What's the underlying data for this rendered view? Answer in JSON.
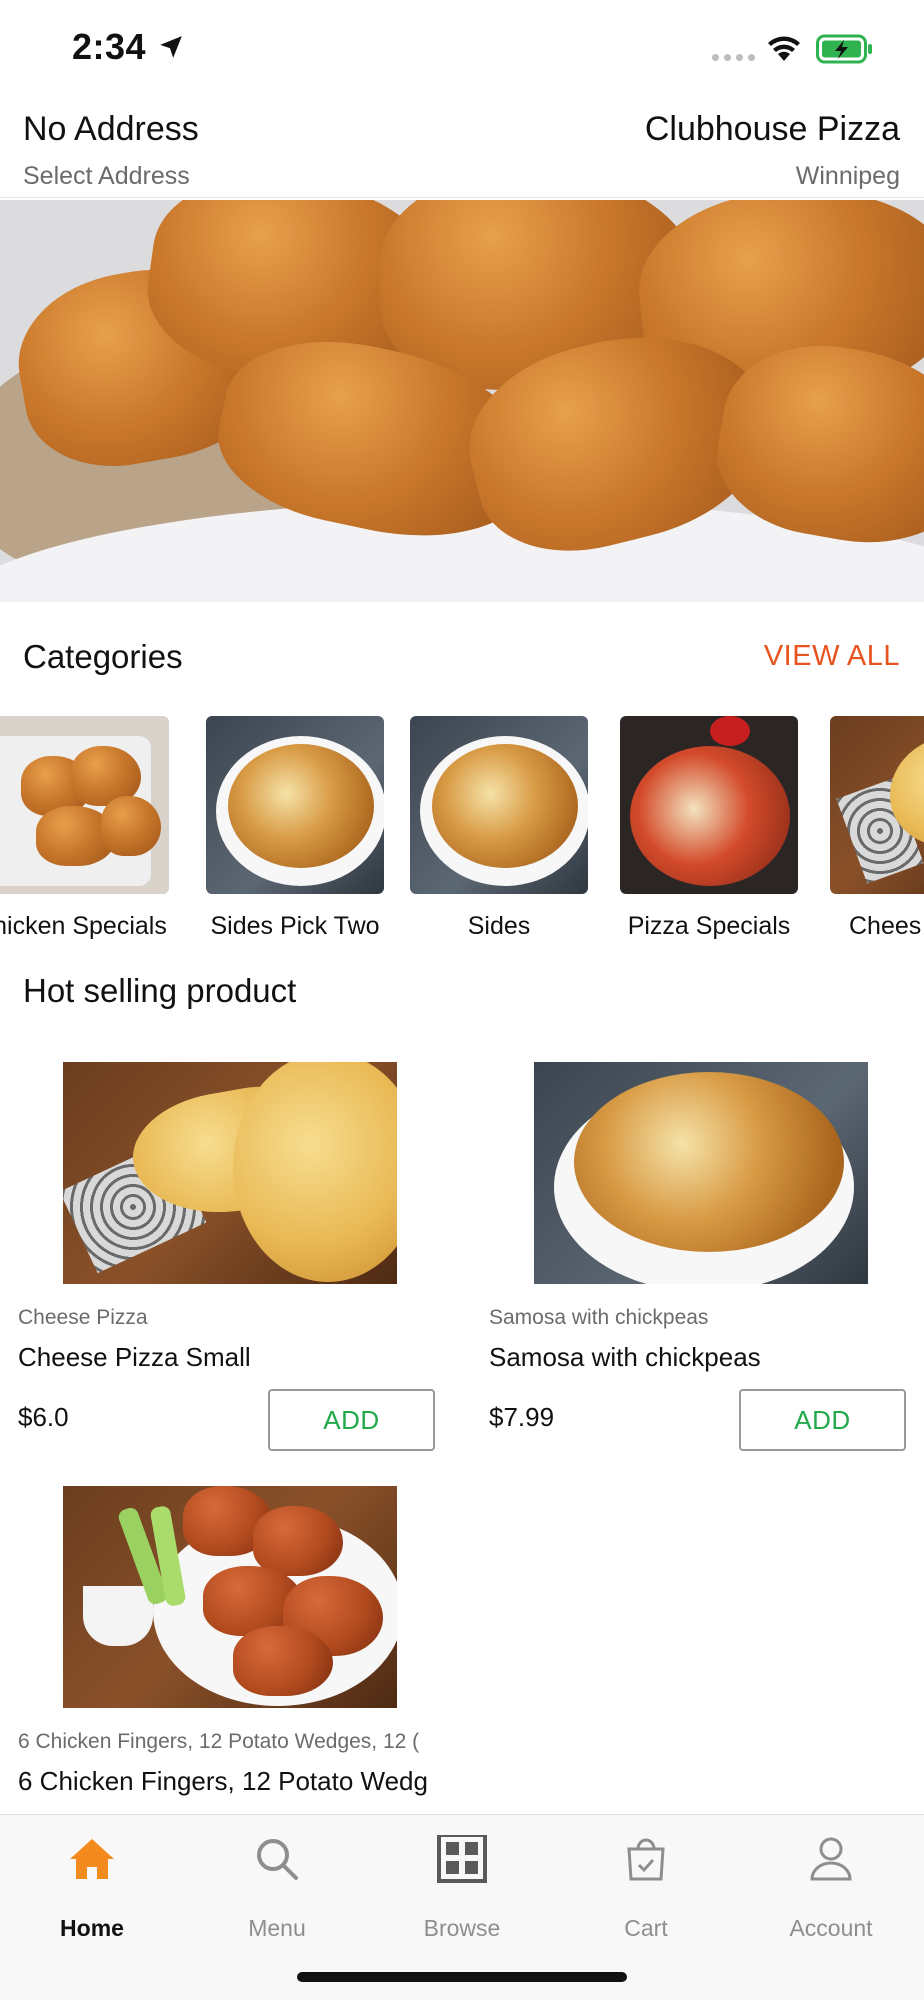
{
  "status_bar": {
    "time": "2:34",
    "icons": [
      "location-arrow-icon",
      "cellular-signal-icon",
      "wifi-icon",
      "battery-charging-icon"
    ]
  },
  "header": {
    "address_title": "No Address",
    "address_subtitle": "Select Address",
    "store_name": "Clubhouse Pizza",
    "store_city": "Winnipeg"
  },
  "banner": {
    "slides_total": 2,
    "active_slide": 1,
    "colors": {
      "active_dot": "#ffe600",
      "idle_dot": "#9e9ea3"
    }
  },
  "categories": {
    "heading": "Categories",
    "view_all": "VIEW ALL",
    "items": [
      {
        "label": "hicken Specials",
        "image": "fried-chicken"
      },
      {
        "label": "Sides Pick Two",
        "image": "poutine"
      },
      {
        "label": "Sides",
        "image": "poutine"
      },
      {
        "label": "Pizza Specials",
        "image": "pizza"
      },
      {
        "label": "Chees",
        "image": "cheese-pizza"
      }
    ]
  },
  "hot_selling": {
    "heading": "Hot selling product",
    "add_label": "ADD",
    "products": [
      {
        "category": "Cheese Pizza",
        "name": "Cheese Pizza Small",
        "price": "$6.0",
        "image": "cheese-pizza"
      },
      {
        "category": "Samosa with chickpeas",
        "name": "Samosa with chickpeas",
        "price": "$7.99",
        "image": "poutine"
      },
      {
        "category": "6 Chicken Fingers, 12 Potato Wedges, 12 (",
        "name": "6 Chicken Fingers, 12 Potato Wedg",
        "price": "",
        "image": "chicken-wings"
      }
    ]
  },
  "tabbar": {
    "active": "Home",
    "items": [
      {
        "label": "Home",
        "icon": "home-icon"
      },
      {
        "label": "Menu",
        "icon": "search-icon"
      },
      {
        "label": "Browse",
        "icon": "grid-icon"
      },
      {
        "label": "Cart",
        "icon": "shopping-bag-icon"
      },
      {
        "label": "Account",
        "icon": "user-icon"
      }
    ]
  },
  "colors": {
    "accent_orange": "#e8541e",
    "add_green": "#22a94a",
    "home_icon_orange": "#f28a1e"
  }
}
